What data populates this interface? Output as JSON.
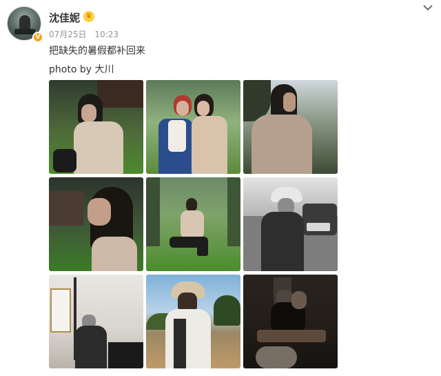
{
  "user": {
    "name": "沈佳妮",
    "avatar_icon": "portrait-avatar",
    "verified_badge": "verified-v-icon",
    "badge_icon": "crown-icon"
  },
  "post": {
    "date": "07月25日",
    "time": "10:23",
    "text": "把缺失的暑假都补回来",
    "credit": "photo by 大川"
  },
  "menu": {
    "icon": "chevron-down-icon"
  },
  "photos": [
    {
      "label": "woman-with-sunglasses-on-lawn"
    },
    {
      "label": "two-women-posing"
    },
    {
      "label": "woman-profile-trees"
    },
    {
      "label": "woman-profile-closeup"
    },
    {
      "label": "woman-sitting-on-grass"
    },
    {
      "label": "monochrome-woman-with-jeep"
    },
    {
      "label": "man-seated-in-room"
    },
    {
      "label": "person-in-bucket-hat-savanna"
    },
    {
      "label": "group-at-dinner-table"
    }
  ],
  "colors": {
    "name": "#333333",
    "meta": "#939393",
    "accent": "#f7a416"
  }
}
